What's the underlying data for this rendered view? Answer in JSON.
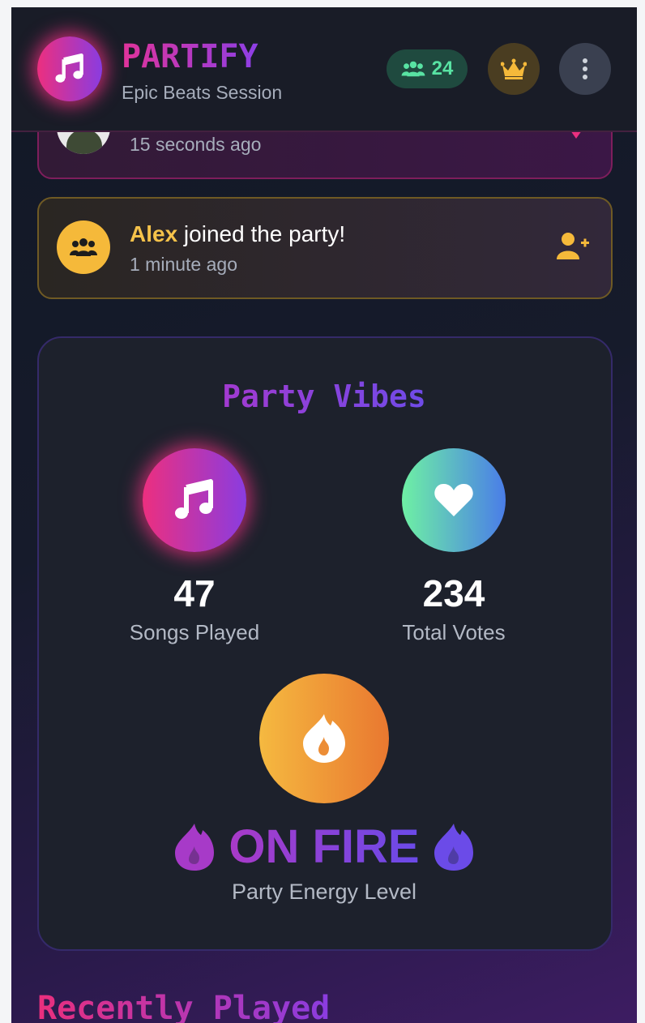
{
  "app": {
    "brand": "PARTIFY",
    "session_name": "Epic Beats Session",
    "listener_count": "24"
  },
  "activity": [
    {
      "type": "vote",
      "time": "15 seconds ago"
    },
    {
      "type": "join",
      "name": "Alex",
      "message": " joined the party!",
      "time": "1 minute ago"
    }
  ],
  "vibes": {
    "title": "Party Vibes",
    "songs_played": {
      "value": "47",
      "label": "Songs Played"
    },
    "total_votes": {
      "value": "234",
      "label": "Total Votes"
    },
    "energy": {
      "value": "ON FIRE",
      "label": "Party Energy Level"
    }
  },
  "sections": {
    "recently_played_title": "Recently Played"
  },
  "colors": {
    "accent_pink": "#ec2f7f",
    "accent_purple": "#8a3ce0",
    "gold": "#f5b93a",
    "green": "#58e3a3"
  },
  "icons": [
    "music-note-icon",
    "users-icon",
    "crown-icon",
    "more-vertical-icon",
    "heart-icon",
    "user-plus-icon",
    "fire-icon"
  ]
}
